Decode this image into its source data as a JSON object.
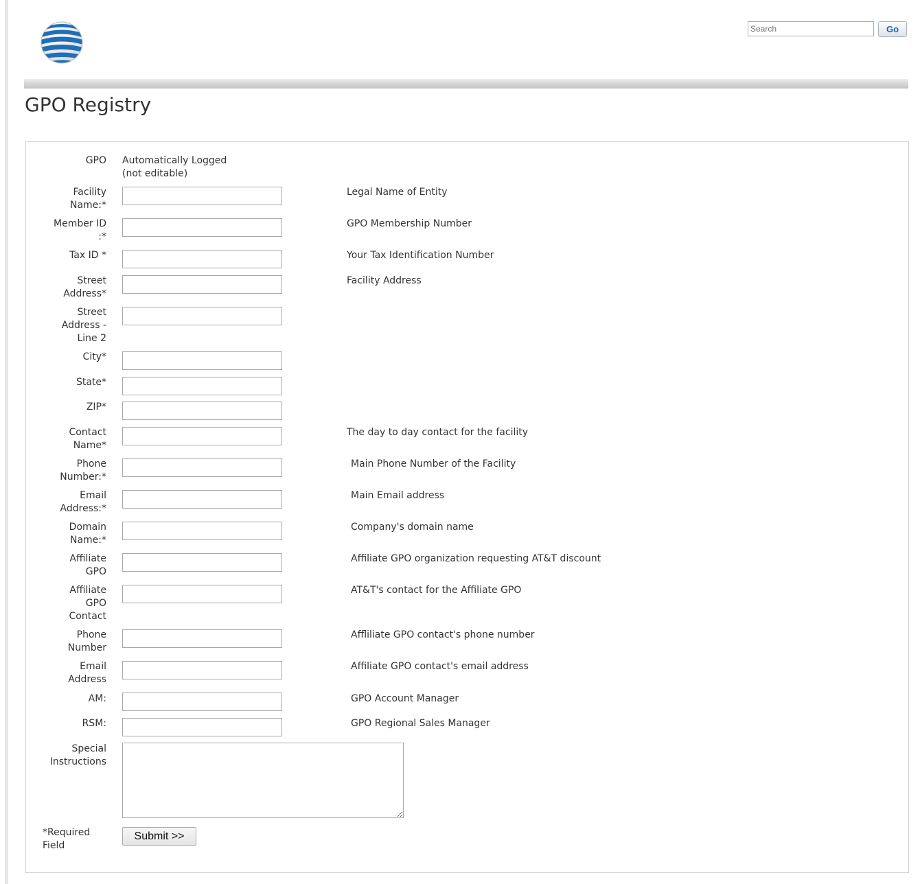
{
  "header": {
    "search": {
      "placeholder": "Search",
      "value": ""
    },
    "go_label": "Go",
    "logo_icon": "att-globe-logo"
  },
  "page": {
    "title": "GPO Registry"
  },
  "form": {
    "gpo": {
      "label": "GPO",
      "value": "Automatically Logged\n(not editable)"
    },
    "fields": [
      {
        "label": "Facility\nName:*",
        "description": "Legal Name of Entity"
      },
      {
        "label": "Member ID\n:*",
        "description": "GPO Membership Number"
      },
      {
        "label": "Tax ID *",
        "description": "Your Tax Identification Number"
      },
      {
        "label": "Street\nAddress*",
        "description": "Facility Address"
      },
      {
        "label": "Street\nAddress -\nLine 2",
        "description": ""
      },
      {
        "label": "City*",
        "description": ""
      },
      {
        "label": "State*",
        "description": ""
      },
      {
        "label": "ZIP*",
        "description": ""
      },
      {
        "label": "Contact\nName*",
        "description": "The day to day contact for the facility"
      },
      {
        "label": "Phone\nNumber:*",
        "description": "Main Phone Number of the Facility"
      },
      {
        "label": "Email\nAddress:*",
        "description": "Main Email address"
      },
      {
        "label": "Domain\nName:*",
        "description": "Company's domain name"
      },
      {
        "label": "Affiliate\nGPO",
        "description": "Affiliate GPO organization requesting AT&T discount"
      },
      {
        "label": "Affiliate\nGPO\nContact",
        "description": "AT&T's contact for the Affiliate GPO"
      },
      {
        "label": "Phone\nNumber",
        "description": "Affliliate GPO contact's phone number"
      },
      {
        "label": "Email\nAddress",
        "description": "Affiliate GPO contact's email address"
      },
      {
        "label": "AM:",
        "description": "GPO Account Manager"
      },
      {
        "label": "RSM:",
        "description": "GPO Regional Sales Manager"
      }
    ],
    "special": {
      "label": "Special\nInstructions",
      "value": ""
    },
    "submit_label": "Submit >>",
    "required_note": "*Required\nField"
  }
}
